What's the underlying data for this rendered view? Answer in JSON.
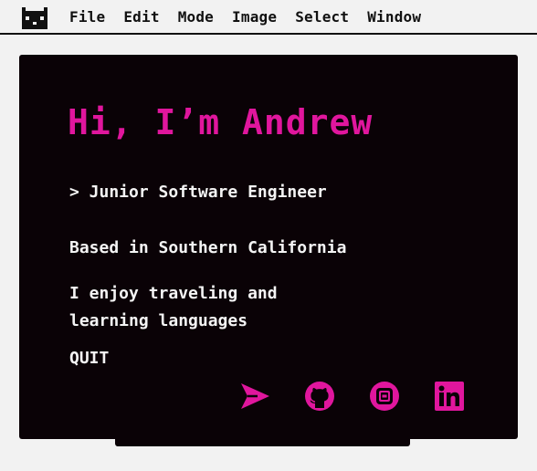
{
  "menubar": {
    "logo_icon": "cat-face-icon",
    "items": [
      "File",
      "Edit",
      "Mode",
      "Image",
      "Select",
      "Window"
    ]
  },
  "window": {
    "greeting": "Hi, I’m Andrew",
    "role": "> Junior Software Engineer",
    "location": "Based in Southern California",
    "hobby_line1": "I enjoy traveling and",
    "hobby_line2": "learning languages",
    "quit_label": "QUIT",
    "social_icons": [
      "send-icon",
      "github-icon",
      "instagram-icon",
      "linkedin-icon"
    ]
  },
  "colors": {
    "accent": "#e0169d",
    "window_bg": "#0a0206",
    "text": "#f4f4f4",
    "page_bg": "#f2f2f2"
  }
}
